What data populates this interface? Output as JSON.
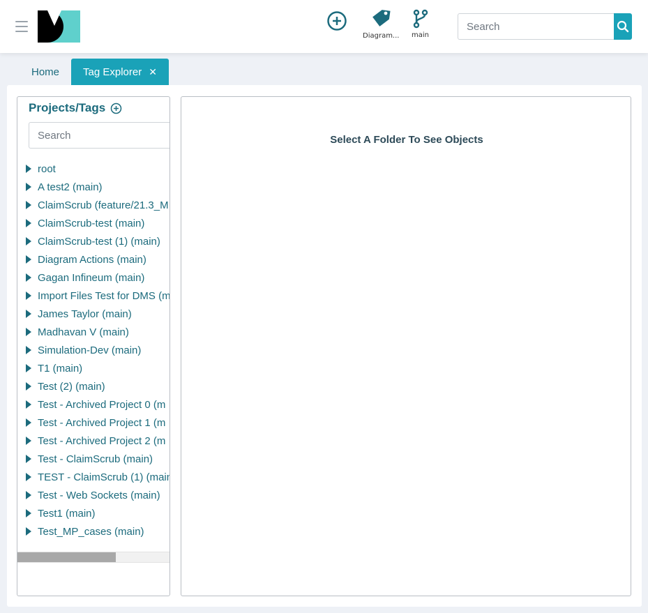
{
  "header": {
    "menu_icon": "hamburger-icon",
    "logo_icon": "dm-logo",
    "actions": [
      {
        "icon": "add-circle-icon",
        "label": ""
      },
      {
        "icon": "tag-icon",
        "label": "Diagram..."
      },
      {
        "icon": "branch-icon",
        "label": "main"
      }
    ],
    "search": {
      "placeholder": "Search",
      "value": "",
      "button_icon": "search-icon"
    }
  },
  "tabs": [
    {
      "label": "Home",
      "active": false
    },
    {
      "label": "Tag Explorer",
      "active": true,
      "close_icon": "close-icon"
    }
  ],
  "left_panel": {
    "title": "Projects/Tags",
    "add_icon": "add-circle-icon",
    "search": {
      "placeholder": "Search",
      "value": "",
      "button_icon": "search-icon"
    },
    "tree": [
      "root",
      "A test2 (main)",
      "ClaimScrub (feature/21.3_M",
      "ClaimScrub-test (main)",
      "ClaimScrub-test (1) (main)",
      "Diagram Actions (main)",
      "Gagan Infineum (main)",
      "Import Files Test for DMS (m",
      "James Taylor (main)",
      "Madhavan V (main)",
      "Simulation-Dev (main)",
      "T1 (main)",
      "Test (2) (main)",
      "Test - Archived Project 0 (m",
      "Test - Archived Project 1 (m",
      "Test - Archived Project 2 (m",
      "Test - ClaimScrub (main)",
      "TEST - ClaimScrub (1) (main",
      "Test - Web Sockets (main)",
      "Test1 (main)",
      "Test_MP_cases (main)"
    ]
  },
  "right_panel": {
    "message": "Select A Folder To See Objects"
  },
  "colors": {
    "accent": "#1aa2b8",
    "text": "#1c6b7d",
    "logo_teal": "#5fd0cc",
    "background": "#eef1f6"
  }
}
